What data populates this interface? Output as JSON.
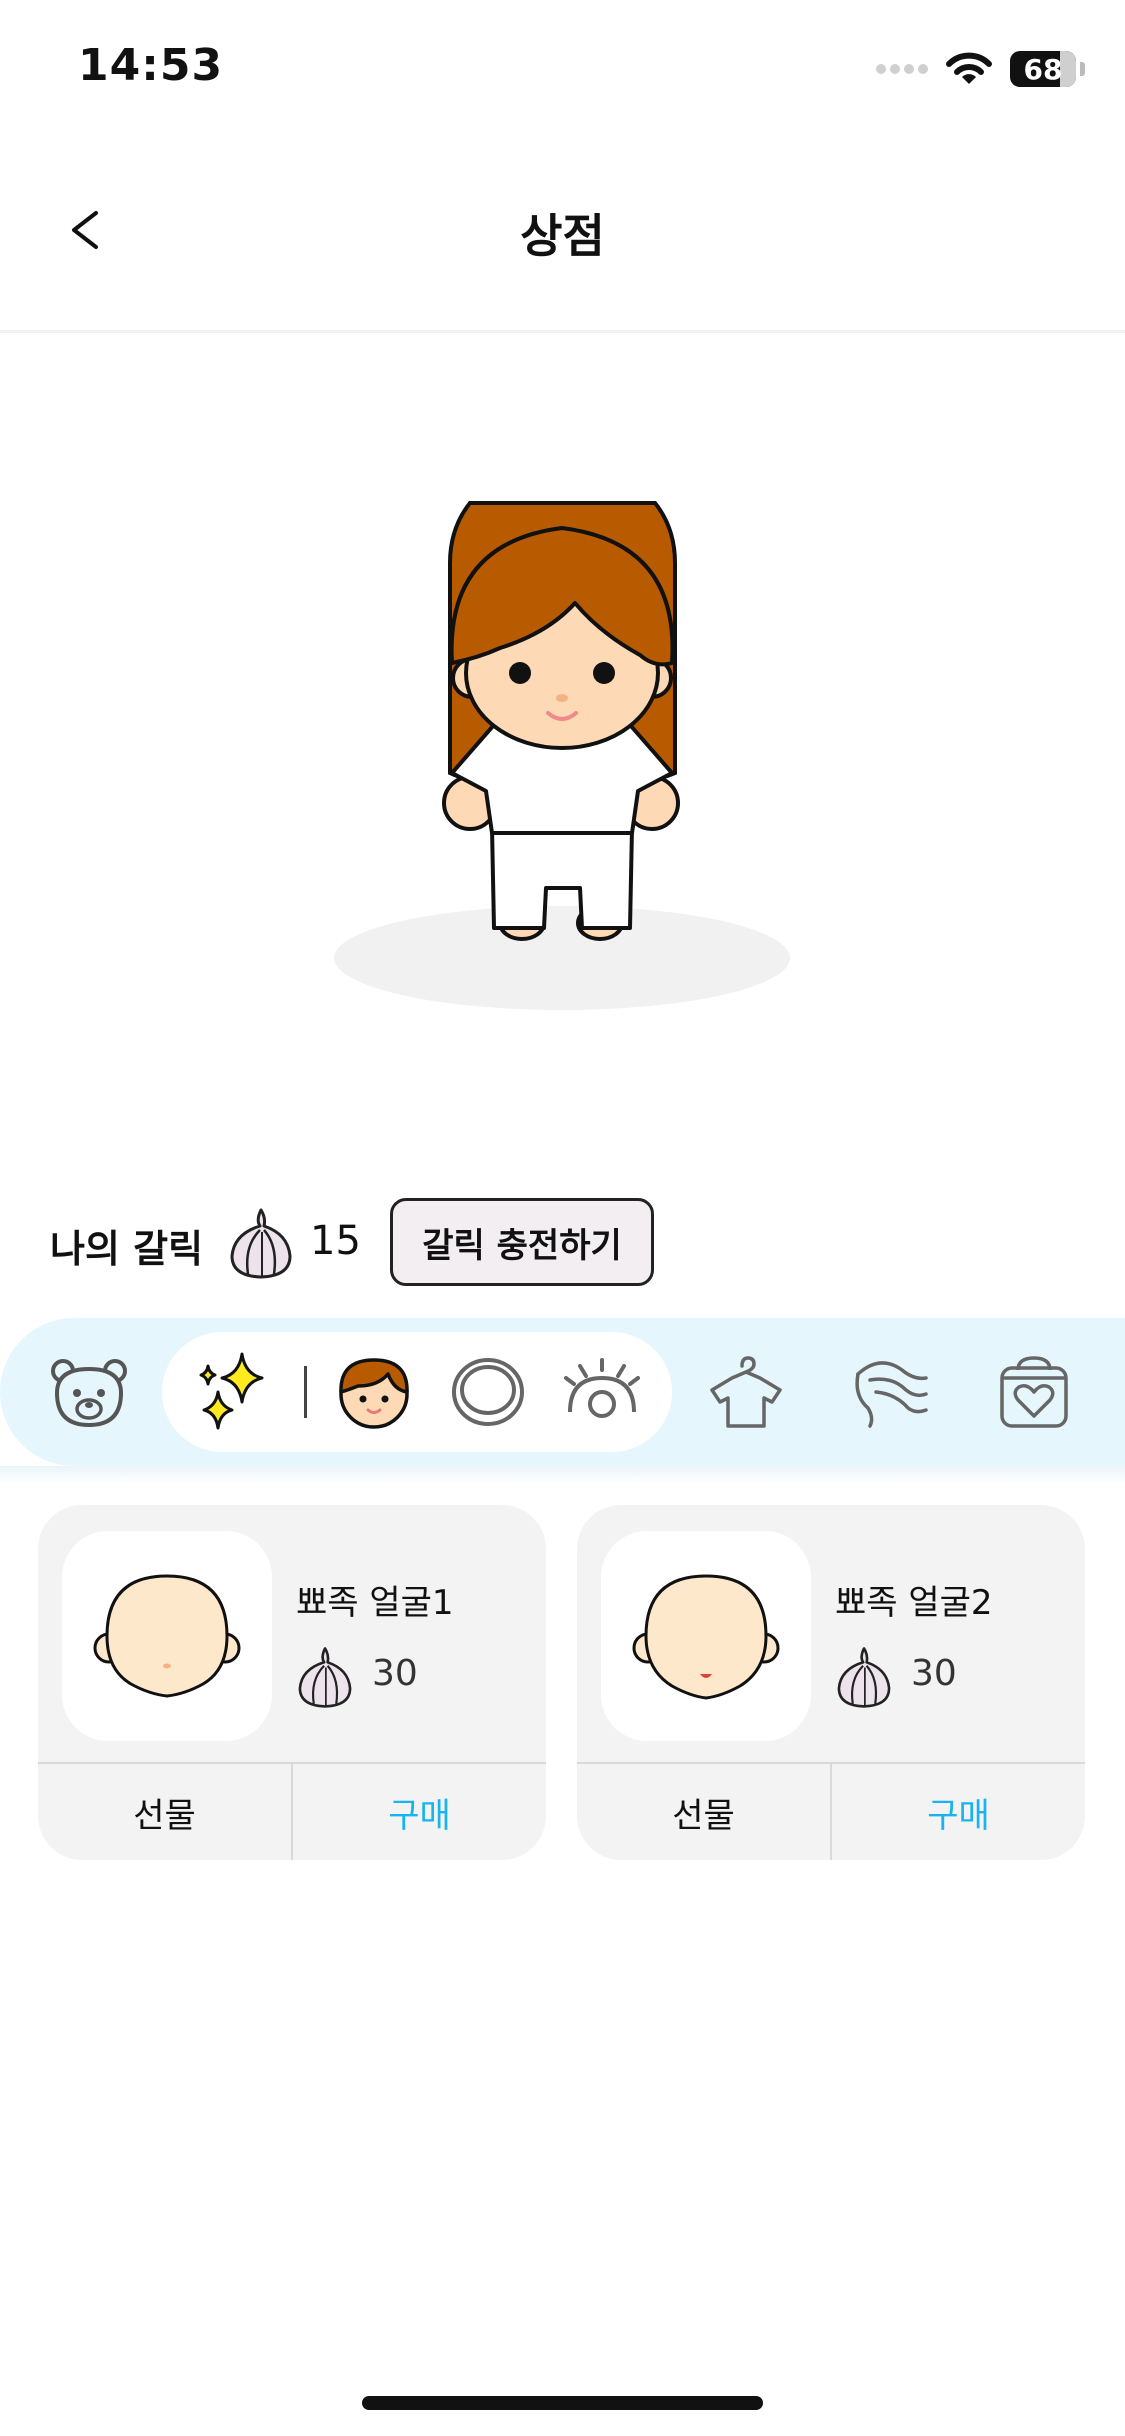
{
  "status_bar": {
    "time": "14:53",
    "battery": "68"
  },
  "header": {
    "title": "상점"
  },
  "wallet": {
    "label": "나의 갈릭",
    "count": "15",
    "charge_label": "갈릭 충전하기"
  },
  "categories": [
    {
      "icon": "bear-icon",
      "selected": false
    },
    {
      "icon": "sparkles-icon",
      "selected": true
    },
    {
      "icon": "face-icon",
      "selected": true
    },
    {
      "icon": "ring-icon",
      "selected": true
    },
    {
      "icon": "eye-icon",
      "selected": true
    },
    {
      "icon": "shirt-icon",
      "selected": false
    },
    {
      "icon": "hair-icon",
      "selected": false
    },
    {
      "icon": "bag-icon",
      "selected": false
    }
  ],
  "products": [
    {
      "name": "뾰족 얼굴1",
      "price": "30",
      "gift_label": "선물",
      "buy_label": "구매"
    },
    {
      "name": "뾰족 얼굴2",
      "price": "30",
      "gift_label": "선물",
      "buy_label": "구매"
    }
  ],
  "colors": {
    "accent": "#19b4f0",
    "category_bg": "#e6f6fd",
    "hair": "#b85a00",
    "skin": "#fdd9b5"
  }
}
